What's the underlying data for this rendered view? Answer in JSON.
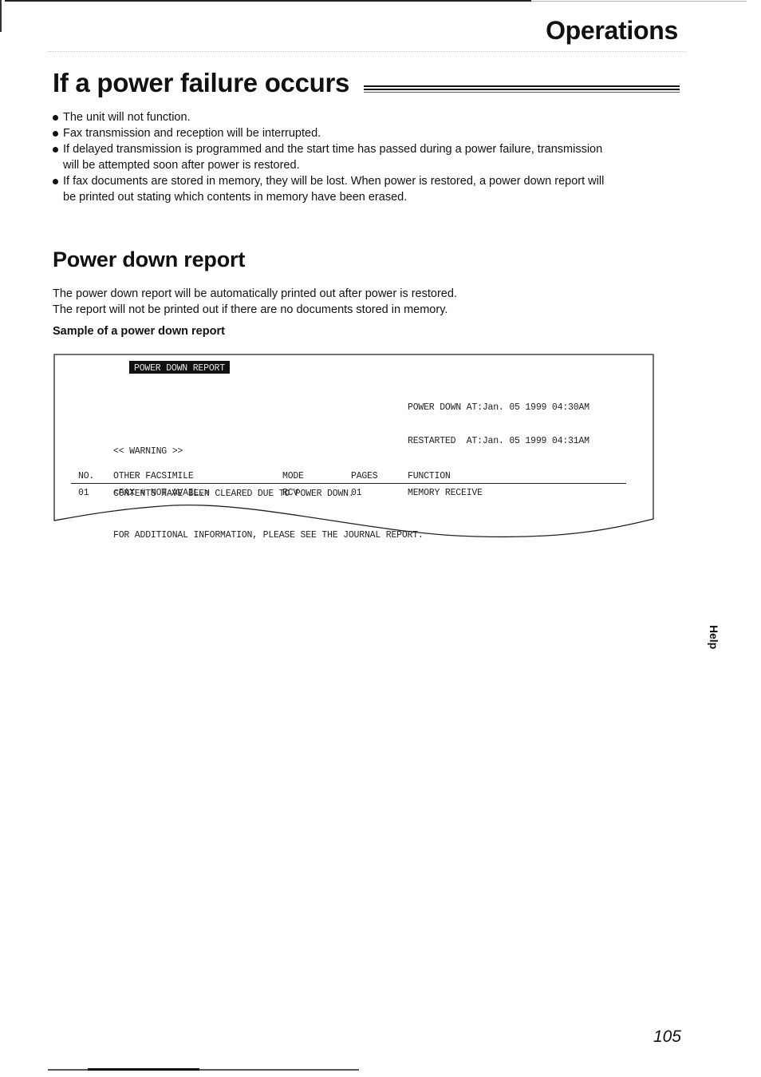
{
  "header": {
    "section_label": "Operations"
  },
  "section1": {
    "title": "If a power failure occurs",
    "bullets": [
      {
        "lines": [
          "The unit will not function."
        ]
      },
      {
        "lines": [
          "Fax transmission and reception will be interrupted."
        ]
      },
      {
        "lines": [
          "If delayed transmission is programmed and the start time has passed during a power failure, transmission",
          "will be attempted soon after power is restored."
        ]
      },
      {
        "lines": [
          "If fax documents are stored in memory, they will be lost. When power is restored, a power down report will",
          "be printed out stating which contents in memory have been erased."
        ]
      }
    ]
  },
  "section2": {
    "title": "Power down report",
    "intro_lines": [
      "The power down report will be automatically printed out after power is restored.",
      "The report will not be printed out if there are no documents stored in memory."
    ],
    "sample_title": "Sample of a power down report"
  },
  "report": {
    "title": "POWER DOWN REPORT",
    "power_down_line": "POWER DOWN AT:Jan. 05 1999 04:30AM",
    "restarted_line": "RESTARTED  AT:Jan. 05 1999 04:31AM",
    "warning_lines": [
      "<< WARNING >>",
      "CONTENTS HAVE BEEN CLEARED DUE TO POWER DOWN.",
      "FOR ADDITIONAL INFORMATION, PLEASE SEE THE JOURNAL REPORT."
    ],
    "columns": [
      "NO.",
      "OTHER FACSIMILE",
      "MODE",
      "PAGES",
      "FUNCTION"
    ],
    "rows": [
      [
        "01",
        "<FAX # NOT AVAIL.>",
        "RCV",
        "01",
        "MEMORY RECEIVE"
      ]
    ]
  },
  "side_tab": {
    "label": "Help"
  },
  "footer": {
    "page_number": "105"
  }
}
